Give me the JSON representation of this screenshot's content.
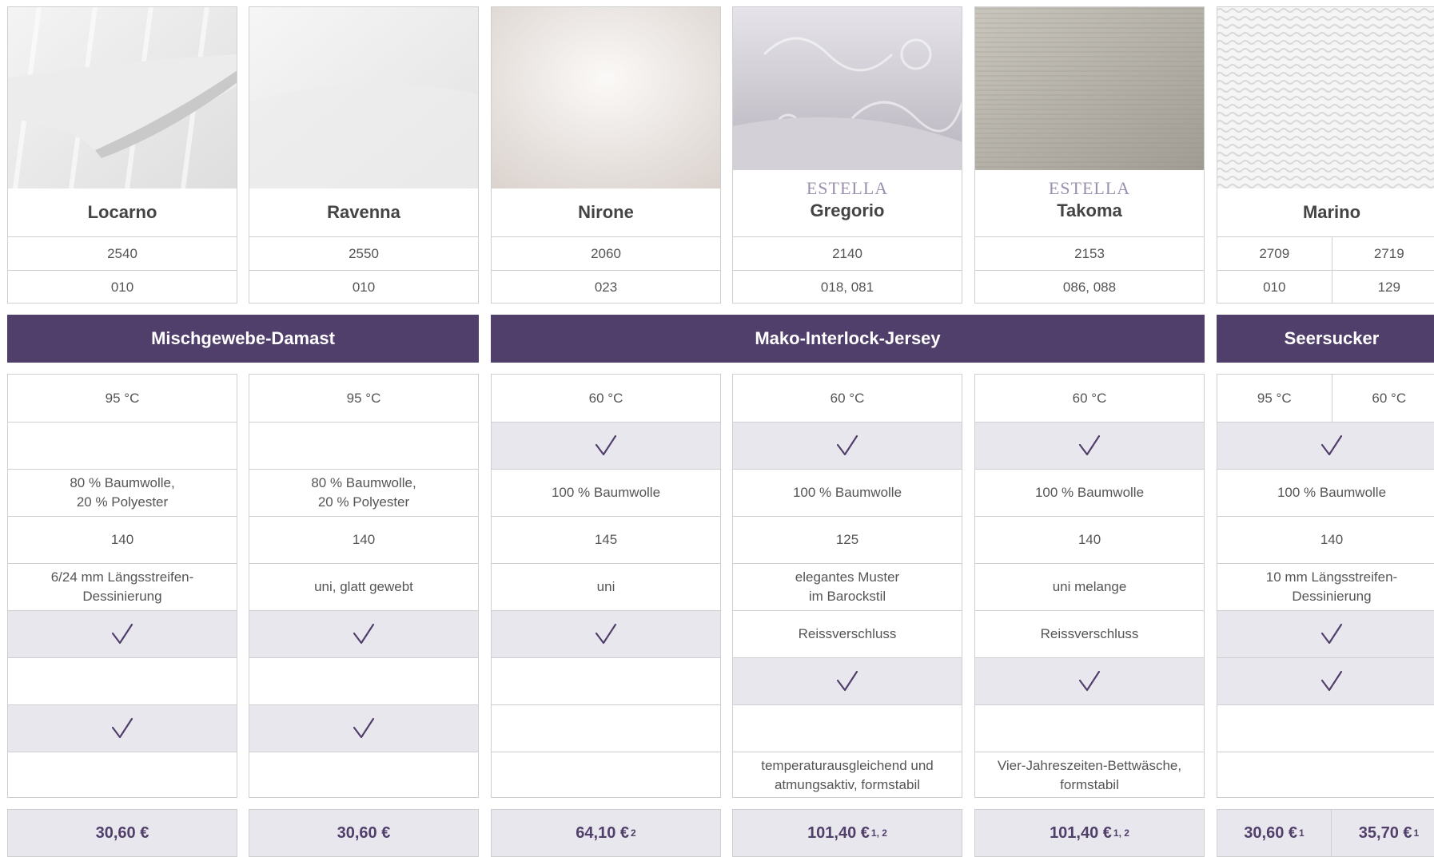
{
  "products": [
    {
      "brand": "",
      "name": "Locarno",
      "article": "2540",
      "color": "010"
    },
    {
      "brand": "",
      "name": "Ravenna",
      "article": "2550",
      "color": "010"
    },
    {
      "brand": "",
      "name": "Nirone",
      "article": "2060",
      "color": "023"
    },
    {
      "brand": "ESTELLA",
      "name": "Gregorio",
      "article": "2140",
      "color": "018, 081"
    },
    {
      "brand": "ESTELLA",
      "name": "Takoma",
      "article": "2153",
      "color": "086, 088"
    },
    {
      "brand": "",
      "name": "Marino",
      "article_a": "2709",
      "article_b": "2719",
      "color_a": "010",
      "color_b": "129"
    }
  ],
  "categories": {
    "damast": "Mischgewebe-Damast",
    "jersey": "Mako-Interlock-Jersey",
    "seersucker": "Seersucker"
  },
  "specs": {
    "locarno": {
      "temp": "95 °C",
      "material_1": "80 % Baumwolle,",
      "material_2": "20 % Polyester",
      "weight": "140",
      "design_1": "6/24 mm Längsstreifen-",
      "design_2": "Dessinierung"
    },
    "ravenna": {
      "temp": "95 °C",
      "material_1": "80 % Baumwolle,",
      "material_2": "20 % Polyester",
      "weight": "140",
      "design": "uni, glatt gewebt"
    },
    "nirone": {
      "temp": "60 °C",
      "material": "100 % Baumwolle",
      "weight": "145",
      "design": "uni"
    },
    "gregorio": {
      "temp": "60 °C",
      "material": "100 % Baumwolle",
      "weight": "125",
      "design_1": "elegantes Muster",
      "design_2": "im Barockstil",
      "closure": "Reissverschluss",
      "note_1": "temperaturausgleichend und",
      "note_2": "atmungsaktiv, formstabil"
    },
    "takoma": {
      "temp": "60 °C",
      "material": "100 % Baumwolle",
      "weight": "140",
      "design": "uni melange",
      "closure": "Reissverschluss",
      "note_1": "Vier-Jahreszeiten-Bettwäsche,",
      "note_2": "formstabil"
    },
    "marino": {
      "temp_a": "95 °C",
      "temp_b": "60 °C",
      "material": "100 % Baumwolle",
      "weight": "140",
      "design_1": "10 mm Längsstreifen-",
      "design_2": "Dessinierung"
    }
  },
  "prices": {
    "locarno": "30,60 €",
    "ravenna": "30,60 €",
    "nirone": "64,10 €",
    "nirone_sup": "2",
    "gregorio": "101,40 €",
    "gregorio_sup": "1, 2",
    "takoma": "101,40 €",
    "takoma_sup": "1, 2",
    "marino_a": "30,60 €",
    "marino_a_sup": "1",
    "marino_b": "35,70 €",
    "marino_b_sup": "1"
  },
  "icons": {
    "check": "checkmark-icon"
  },
  "colors": {
    "accent": "#513f6b",
    "shade": "#e9e7ee",
    "border": "#cfcfcf",
    "brand": "#9b90ad"
  }
}
